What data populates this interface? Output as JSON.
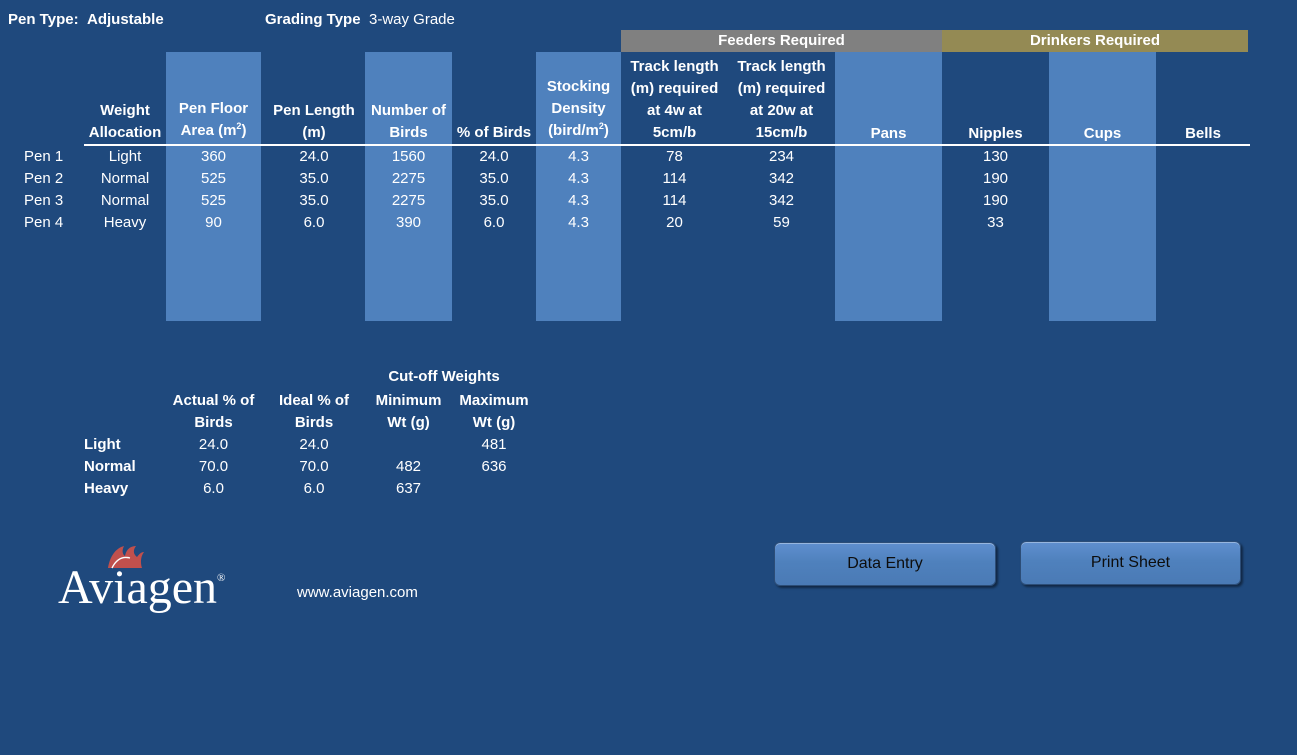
{
  "header": {
    "pen_type_label": "Pen Type:",
    "pen_type_value": "Adjustable",
    "grading_type_label": "Grading Type",
    "grading_type_value": "3-way Grade"
  },
  "groups": {
    "feeders": "Feeders Required",
    "drinkers": "Drinkers Required"
  },
  "columns": {
    "weight_1": "Weight",
    "weight_2": "Allocation",
    "floor_1": "Pen Floor",
    "floor_2": "Area (m",
    "floor_sup": "2",
    "floor_close": ")",
    "length_1": "Pen Length",
    "length_2": "(m)",
    "birds_1": "Number of",
    "birds_2": "Birds",
    "pct": "% of Birds",
    "density_1": "Stocking",
    "density_2": "Density",
    "density_3": "(bird/m",
    "density_sup": "2",
    "density_close": ")",
    "track4_1": "Track length",
    "track4_2": "(m) required",
    "track4_3": "at 4w at",
    "track4_4": "5cm/b",
    "track20_1": "Track length",
    "track20_2": "(m) required",
    "track20_3": "at 20w at",
    "track20_4": "15cm/b",
    "pans": "Pans",
    "nipples": "Nipples",
    "cups": "Cups",
    "bells": "Bells"
  },
  "pens": [
    {
      "name": "Pen 1",
      "weight": "Light",
      "floor": "360",
      "length": "24.0",
      "birds": "1560",
      "pct": "24.0",
      "density": "4.3",
      "track4": "78",
      "track20": "234",
      "nipples": "130"
    },
    {
      "name": "Pen 2",
      "weight": "Normal",
      "floor": "525",
      "length": "35.0",
      "birds": "2275",
      "pct": "35.0",
      "density": "4.3",
      "track4": "114",
      "track20": "342",
      "nipples": "190"
    },
    {
      "name": "Pen 3",
      "weight": "Normal",
      "floor": "525",
      "length": "35.0",
      "birds": "2275",
      "pct": "35.0",
      "density": "4.3",
      "track4": "114",
      "track20": "342",
      "nipples": "190"
    },
    {
      "name": "Pen 4",
      "weight": "Heavy",
      "floor": "90",
      "length": "6.0",
      "birds": "390",
      "pct": "6.0",
      "density": "4.3",
      "track4": "20",
      "track20": "59",
      "nipples": "33"
    }
  ],
  "summary": {
    "cutoff_title": "Cut-off Weights",
    "actual_1": "Actual % of",
    "actual_2": "Birds",
    "ideal_1": "Ideal % of",
    "ideal_2": "Birds",
    "min_1": "Minimum",
    "min_2": "Wt (g)",
    "max_1": "Maximum",
    "max_2": "Wt (g)",
    "rows": [
      {
        "label": "Light",
        "actual": "24.0",
        "ideal": "24.0",
        "min": "",
        "max": "481"
      },
      {
        "label": "Normal",
        "actual": "70.0",
        "ideal": "70.0",
        "min": "482",
        "max": "636"
      },
      {
        "label": "Heavy",
        "actual": "6.0",
        "ideal": "6.0",
        "min": "637",
        "max": ""
      }
    ]
  },
  "footer": {
    "logo_text": "Aviagen",
    "registered": "®",
    "website": "www.aviagen.com",
    "data_entry_button": "Data Entry",
    "print_sheet_button": "Print Sheet"
  },
  "colors": {
    "background": "#1f497d",
    "column_band": "#4f81bd",
    "feeders_header": "#808080",
    "drinkers_header": "#948a54",
    "logo_red": "#c0504d"
  }
}
